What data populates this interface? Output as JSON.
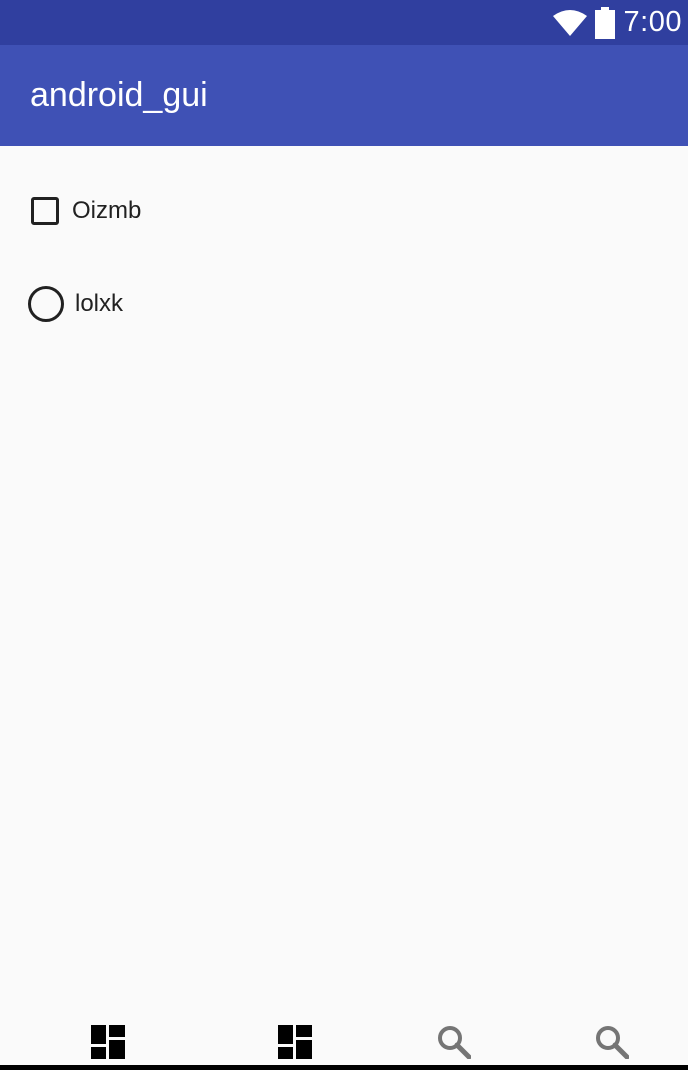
{
  "status_bar": {
    "time": "7:00",
    "icons": [
      "wifi-icon",
      "battery-icon"
    ],
    "background": "#303f9f"
  },
  "app_bar": {
    "title": "android_gui",
    "background": "#3f51b5"
  },
  "content": {
    "checkbox": {
      "label": "Oizmb",
      "checked": false
    },
    "radio": {
      "label": "lolxk",
      "checked": false
    }
  },
  "bottom_nav": {
    "items": [
      {
        "icon": "dashboard-icon",
        "color": "#000000"
      },
      {
        "icon": "dashboard-icon",
        "color": "#000000"
      },
      {
        "icon": "search-icon",
        "color": "#757575"
      },
      {
        "icon": "search-icon",
        "color": "#757575"
      }
    ]
  },
  "colors": {
    "primary": "#3f51b5",
    "primary_dark": "#303f9f",
    "background": "#fafafa",
    "text": "#212121"
  }
}
